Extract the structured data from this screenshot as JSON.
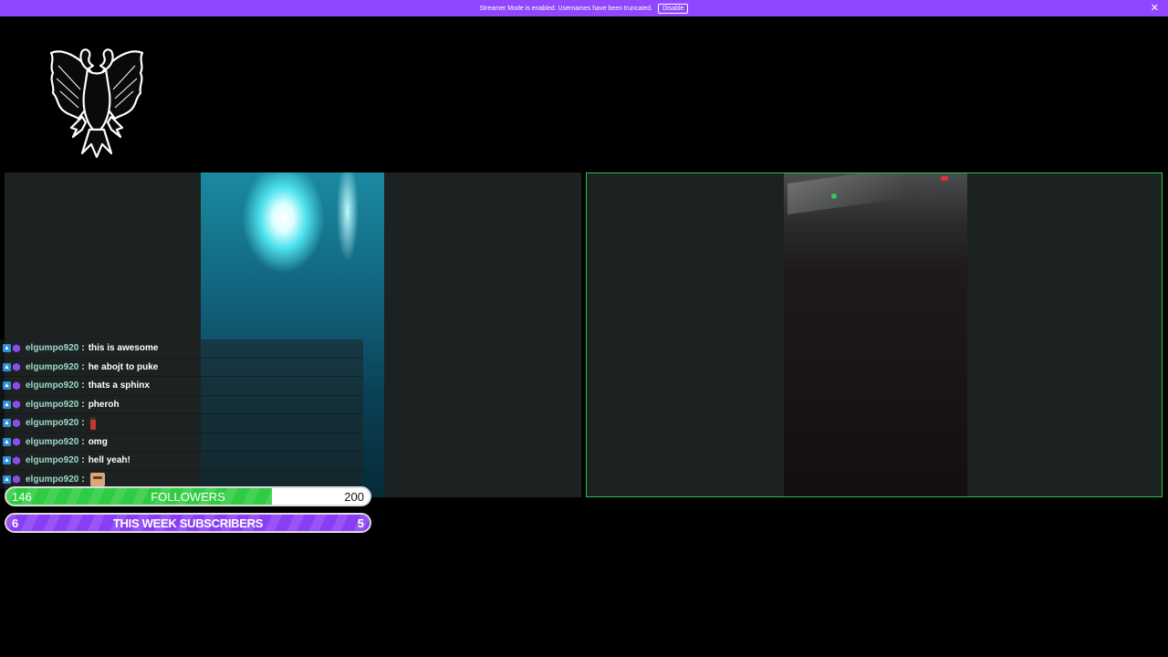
{
  "banner": {
    "text": "Streamer Mode is enabled. Usernames have been truncated.",
    "disable_label": "Disable",
    "close_glyph": "✕"
  },
  "logo": {
    "icon": "double-headed-eagle-icon"
  },
  "chat": {
    "messages": [
      {
        "user": "elgumpo920",
        "text": "this is awesome"
      },
      {
        "user": "elgumpo920",
        "text": "he abojt to puke"
      },
      {
        "user": "elgumpo920",
        "text": "thats a sphinx"
      },
      {
        "user": "elgumpo920",
        "text": "pheroh"
      },
      {
        "user": "elgumpo920",
        "text": "",
        "emote": "bottle-emote"
      },
      {
        "user": "elgumpo920",
        "text": "omg"
      },
      {
        "user": "elgumpo920",
        "text": "hell yeah!"
      },
      {
        "user": "elgumpo920",
        "text": "",
        "emote": "face-emote"
      }
    ],
    "separator": ":"
  },
  "goals": {
    "followers": {
      "current": "146",
      "label": "FOLLOWERS",
      "target": "200",
      "progress": 0.73,
      "color": "#2ecc40"
    },
    "subscribers": {
      "current": "6",
      "label": "THIS WEEK SUBSCRIBERS",
      "target": "5",
      "progress": 1.0,
      "color": "#8a3df5"
    }
  },
  "colors": {
    "banner": "#9147ff",
    "accent_border": "#2fbf4a",
    "username": "#9fd8c8"
  }
}
